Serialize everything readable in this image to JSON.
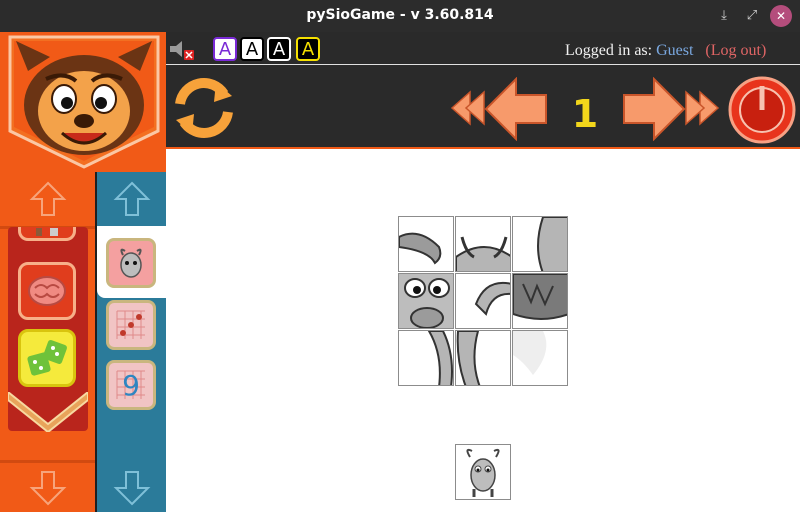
{
  "window": {
    "title": "pySioGame - v 3.60.814",
    "min_icon": "download-icon",
    "max_icon": "maximize-icon",
    "close_icon": "close-icon"
  },
  "header": {
    "font_buttons": [
      {
        "label": "A",
        "bg": "#ffffff",
        "fg": "#7a2ad6",
        "border": "#7a2ad6"
      },
      {
        "label": "A",
        "bg": "#ffffff",
        "fg": "#000000",
        "border": "#000000"
      },
      {
        "label": "A",
        "bg": "#000000",
        "fg": "#ffffff",
        "border": "#ffffff"
      },
      {
        "label": "A",
        "bg": "#000000",
        "fg": "#f5e000",
        "border": "#f5e000"
      }
    ],
    "login_prefix": "Logged in as:",
    "username": "Guest",
    "logout": "(Log out)"
  },
  "toolbar": {
    "level": "1",
    "icons": [
      "reload-icon",
      "first-level-icon",
      "previous-level-icon",
      "next-level-icon",
      "last-level-icon",
      "power-icon"
    ]
  },
  "sidebar": {
    "categories": [
      "chess-icon",
      "brain-icon",
      "dice-icon"
    ],
    "active_category": "dice-icon",
    "games": [
      "goat-icon",
      "graph-icon",
      "number-nine-icon"
    ],
    "active_game": "goat-icon"
  },
  "colors": {
    "accent_orange": "#f15a17",
    "sidebar_blue": "#2b7b9a",
    "level_yellow": "#f2d61b",
    "dark_bar": "#2a2a2a"
  },
  "puzzle": {
    "rows": 3,
    "cols": 3,
    "pieces": [
      "horn-left",
      "head-top",
      "horn-right-edge",
      "eye-left",
      "horn-middle",
      "beard-right",
      "leg-left",
      "leg-middle",
      "body-right"
    ]
  }
}
